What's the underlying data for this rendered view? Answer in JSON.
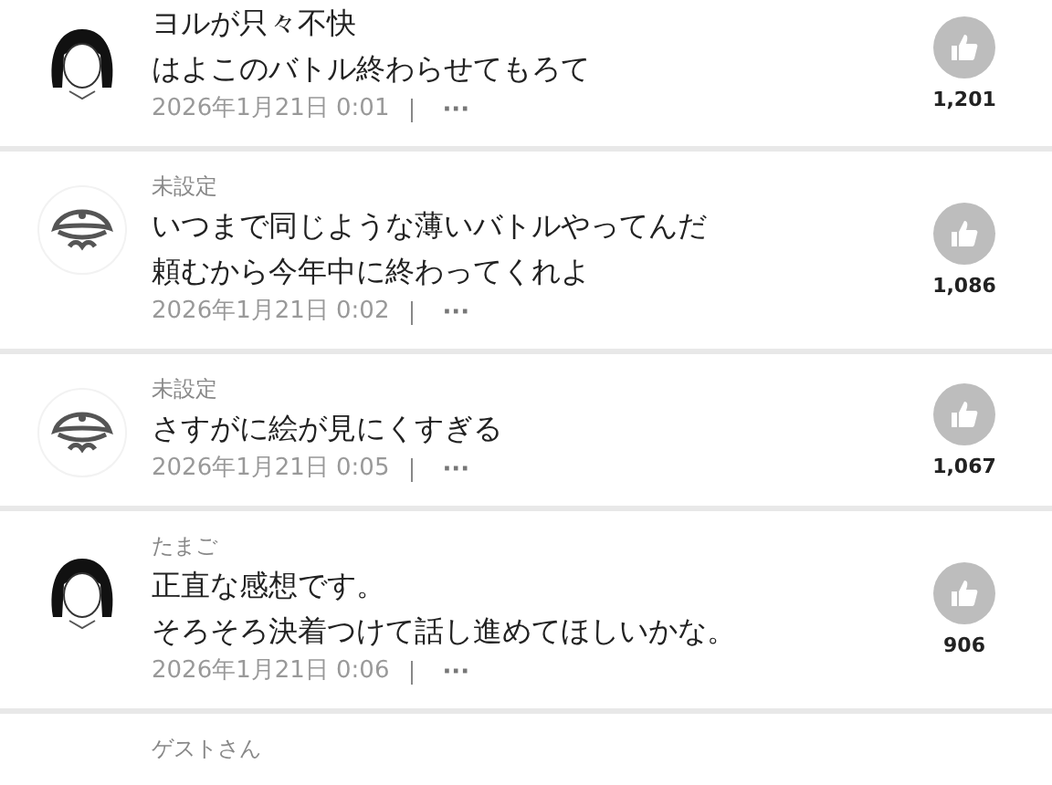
{
  "comments": [
    {
      "kind": "girl",
      "lines": [
        "ヨルが只々不快",
        "はよこのバトル終わらせてもろて"
      ],
      "date": "2026年1月21日 0:01",
      "more": "···",
      "likes": "1,201"
    },
    {
      "kind": "pirate",
      "name": "未設定",
      "lines": [
        "いつまで同じような薄いバトルやってんだ",
        "頼むから今年中に終わってくれよ"
      ],
      "date": "2026年1月21日 0:02",
      "more": "···",
      "likes": "1,086"
    },
    {
      "kind": "pirate",
      "name": "未設定",
      "lines": [
        "さすがに絵が見にくすぎる"
      ],
      "date": "2026年1月21日 0:05",
      "more": "···",
      "likes": "1,067"
    },
    {
      "kind": "girl",
      "name": "たまご",
      "lines": [
        "正直な感想です。",
        "そろそろ決着つけて話し進めてほしいかな。"
      ],
      "date": "2026年1月21日 0:06",
      "more": "···",
      "likes": "906"
    },
    {
      "name": "ゲストさん"
    }
  ]
}
